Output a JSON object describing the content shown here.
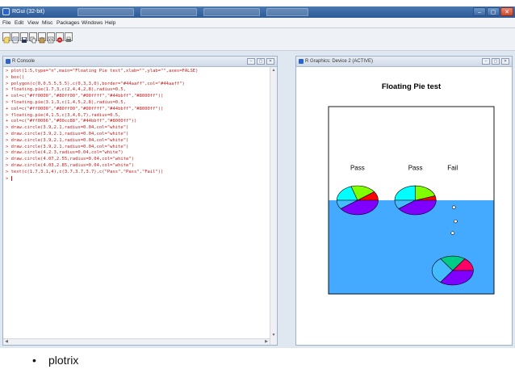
{
  "app": {
    "title": "RGui (32-bit)",
    "window_buttons": [
      "–",
      "▢",
      "✕"
    ]
  },
  "menu": {
    "items": [
      "File",
      "Edit",
      "View",
      "Misc",
      "Packages",
      "Windows",
      "Help"
    ]
  },
  "toolbar": {
    "icons": [
      "open-script-icon",
      "load-workspace-icon",
      "save-workspace-icon",
      "copy-icon",
      "paste-icon",
      "copy-paste-icon",
      "stop-icon",
      "print-icon"
    ]
  },
  "console": {
    "title": "R Console",
    "prompt": ">",
    "continuation": "+",
    "lines": [
      {
        "p": ">",
        "t": "plot(1:5,type=\"n\",main=\"Floating Pie test\",xlab=\"\",ylab=\"\",axes=FALSE)"
      },
      {
        "p": ">",
        "t": "box()"
      },
      {
        "p": ">",
        "t": "polygon(c(0,0,5.5,5.5),c(0,3,3,0),border=\"#44aaff\",col=\"#44aaff\")"
      },
      {
        "p": ">",
        "t": "floating.pie(1.7,3,c(2,4,4,2,8),radius=0.5,"
      },
      {
        "p": "+",
        "t": "col=c(\"#ff0000\",\"#80ff00\",\"#00ffff\",\"#44bbff\",\"#8000ff\"))"
      },
      {
        "p": ">",
        "t": "floating.pie(3.1,3,c(1,4,5,2,8),radius=0.5,"
      },
      {
        "p": "+",
        "t": "col=c(\"#ff0000\",\"#80ff00\",\"#00ffff\",\"#44bbff\",\"#8000ff\"))"
      },
      {
        "p": ">",
        "t": "floating.pie(4,1.5,c(3,4,6,7),radius=0.5,"
      },
      {
        "p": "+",
        "t": "col=c(\"#ff0066\",\"#00cc88\",\"#44bbff\",\"#8000ff\"))"
      },
      {
        "p": ">",
        "t": "draw.circle(3.9,2.1,radius=0.04,col=\"white\")"
      },
      {
        "p": ">",
        "t": "draw.circle(3.9,2.1,radius=0.04,col=\"white\")"
      },
      {
        "p": ">",
        "t": "draw.circle(3.9,2.1,radius=0.04,col=\"white\")"
      },
      {
        "p": ">",
        "t": "draw.circle(3.9,2.1,radius=0.04,col=\"white\")"
      },
      {
        "p": ">",
        "t": "draw.circle(4,2.3,radius=0.04,col=\"white\")"
      },
      {
        "p": ">",
        "t": "draw.circle(4.07,2.55,radius=0.04,col=\"white\")"
      },
      {
        "p": ">",
        "t": "draw.circle(4.03,2.85,radius=0.04,col=\"white\")"
      },
      {
        "p": ">",
        "t": "text(c(1.7,3.1,4),c(3.7,3.7,3.7),c(\"Pass\",\"Pass\",\"Fail\"))"
      },
      {
        "p": ">",
        "t": ""
      }
    ]
  },
  "graphics": {
    "title": "R Graphics: Device 2 (ACTIVE)"
  },
  "chart_data": {
    "type": "pie",
    "title": "Floating Pie test",
    "xlabel": "",
    "ylabel": "",
    "xlim": [
      1,
      5
    ],
    "ylim": [
      1,
      5
    ],
    "axes": false,
    "water": {
      "x": [
        0,
        5.5
      ],
      "y": [
        0,
        3
      ],
      "color": "#44aaff"
    },
    "pies": [
      {
        "x": 1.7,
        "y": 3,
        "radius": 0.5,
        "values": [
          2,
          4,
          4,
          2,
          8
        ],
        "colors": [
          "#ff0000",
          "#80ff00",
          "#00ffff",
          "#44bbff",
          "#8000ff"
        ]
      },
      {
        "x": 3.1,
        "y": 3,
        "radius": 0.5,
        "values": [
          1,
          4,
          5,
          2,
          8
        ],
        "colors": [
          "#ff0000",
          "#80ff00",
          "#00ffff",
          "#44bbff",
          "#8000ff"
        ]
      },
      {
        "x": 4,
        "y": 1.5,
        "radius": 0.5,
        "values": [
          3,
          4,
          6,
          7
        ],
        "colors": [
          "#ff0066",
          "#00cc88",
          "#44bbff",
          "#8000ff"
        ]
      }
    ],
    "bubbles": [
      {
        "x": 4,
        "y": 2.3,
        "radius": 0.04
      },
      {
        "x": 4.07,
        "y": 2.55,
        "radius": 0.04
      },
      {
        "x": 4.03,
        "y": 2.85,
        "radius": 0.04
      }
    ],
    "labels": [
      {
        "x": 1.7,
        "y": 3.7,
        "text": "Pass"
      },
      {
        "x": 3.1,
        "y": 3.7,
        "text": "Pass"
      },
      {
        "x": 4,
        "y": 3.7,
        "text": "Fail"
      }
    ]
  },
  "slide": {
    "bullet": "•",
    "text": "plotrix"
  }
}
